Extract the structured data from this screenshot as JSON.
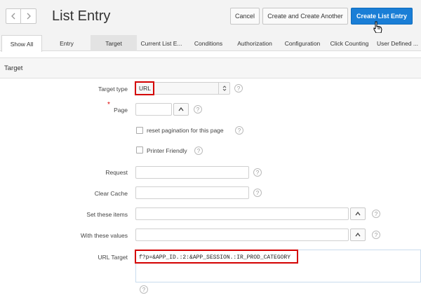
{
  "header": {
    "title": "List Entry",
    "cancel_label": "Cancel",
    "create_another_label": "Create and Create Another",
    "create_label": "Create List Entry"
  },
  "tabs": [
    {
      "label": "Show All"
    },
    {
      "label": "Entry"
    },
    {
      "label": "Target"
    },
    {
      "label": "Current List E..."
    },
    {
      "label": "Conditions"
    },
    {
      "label": "Authorization"
    },
    {
      "label": "Configuration"
    },
    {
      "label": "Click Counting"
    },
    {
      "label": "User Defined ..."
    }
  ],
  "active_tab": "Target",
  "region": {
    "title": "Target"
  },
  "form": {
    "target_type": {
      "label": "Target type",
      "value": "URL"
    },
    "page": {
      "label": "Page",
      "value": ""
    },
    "reset_pagination": {
      "label": "reset pagination for this page",
      "checked": false
    },
    "printer_friendly": {
      "label": "Printer Friendly",
      "checked": false
    },
    "request": {
      "label": "Request",
      "value": ""
    },
    "clear_cache": {
      "label": "Clear Cache",
      "value": ""
    },
    "set_items": {
      "label": "Set these items",
      "value": ""
    },
    "with_values": {
      "label": "With these values",
      "value": ""
    },
    "url_target": {
      "label": "URL Target",
      "value": "f?p=&APP_ID.:2:&APP_SESSION.:IR_PROD_CATEGORY"
    }
  },
  "colors": {
    "primary": "#1a7ed6",
    "highlight": "#d40000"
  },
  "icons": {
    "help": "?",
    "chevron_up": "^"
  }
}
